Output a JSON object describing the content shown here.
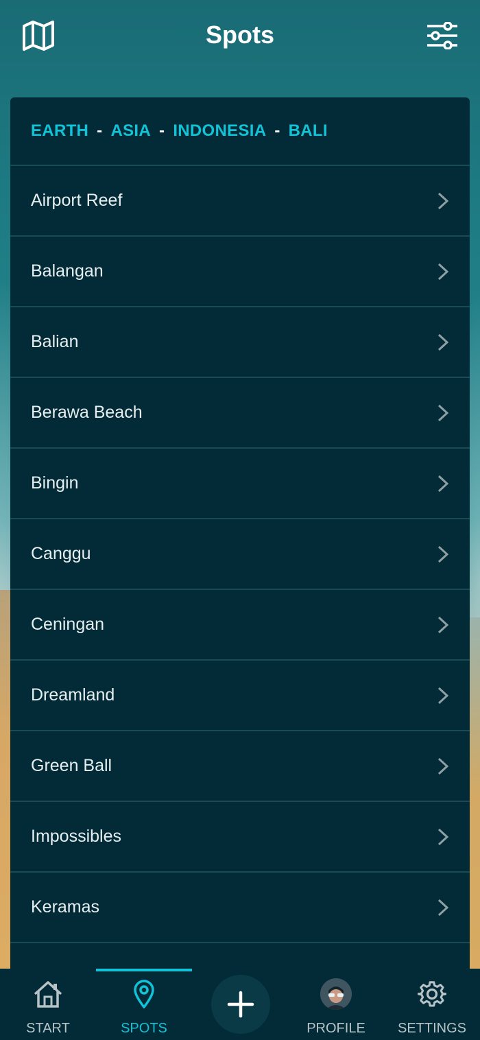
{
  "header": {
    "title": "Spots",
    "map_icon": "map-icon",
    "filter_icon": "sliders-icon"
  },
  "breadcrumb": {
    "items": [
      "EARTH",
      "ASIA",
      "INDONESIA",
      "BALI"
    ],
    "separator": "-"
  },
  "spots": [
    {
      "name": "Airport Reef"
    },
    {
      "name": "Balangan"
    },
    {
      "name": "Balian"
    },
    {
      "name": "Berawa Beach"
    },
    {
      "name": "Bingin"
    },
    {
      "name": "Canggu"
    },
    {
      "name": "Ceningan"
    },
    {
      "name": "Dreamland"
    },
    {
      "name": "Green Ball"
    },
    {
      "name": "Impossibles"
    },
    {
      "name": "Keramas"
    }
  ],
  "nav": {
    "start": "START",
    "spots": "SPOTS",
    "profile": "PROFILE",
    "settings": "SETTINGS",
    "active": "spots"
  },
  "colors": {
    "accent": "#12c2d6",
    "card": "#022b37",
    "divider": "#1a4a53"
  }
}
